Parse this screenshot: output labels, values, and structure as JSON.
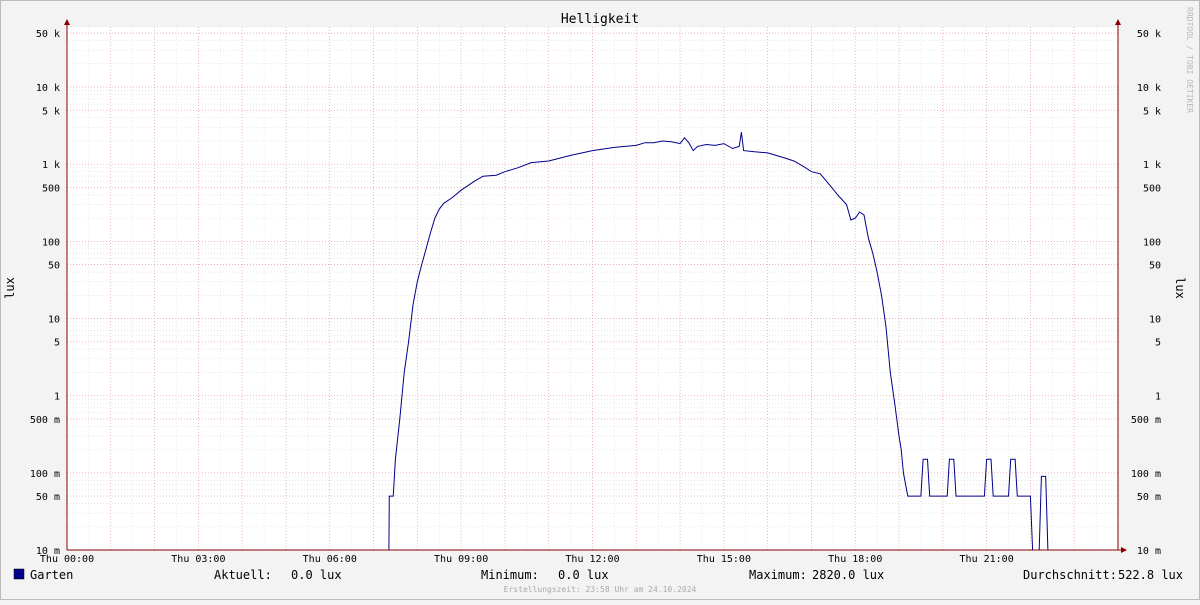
{
  "chart_data": {
    "type": "line",
    "title": "Helligkeit",
    "ylabel": "lux",
    "ylabel_right": "lux",
    "y_scale": "log",
    "ylim": [
      10,
      60000
    ],
    "xlim": [
      0,
      24
    ],
    "x_unit": "hours",
    "y_ticks": [
      {
        "value": 50000,
        "label": "50 k"
      },
      {
        "value": 10000,
        "label": "10 k"
      },
      {
        "value": 5000,
        "label": "5 k"
      },
      {
        "value": 1000,
        "label": "1 k"
      },
      {
        "value": 500,
        "label": "500"
      },
      {
        "value": 100,
        "label": "100"
      },
      {
        "value": 50,
        "label": "50"
      },
      {
        "value": 10,
        "label": "10"
      },
      {
        "value": 5,
        "label": "5"
      },
      {
        "value": 1,
        "label": "1"
      },
      {
        "value": 0.5,
        "label": "500 m"
      },
      {
        "value": 0.1,
        "label": "100 m"
      },
      {
        "value": 0.05,
        "label": "50 m"
      },
      {
        "value": 0.01,
        "label": "10 m"
      }
    ],
    "x_ticks": [
      {
        "value": 0,
        "label": "Thu 00:00"
      },
      {
        "value": 3,
        "label": "Thu 03:00"
      },
      {
        "value": 6,
        "label": "Thu 06:00"
      },
      {
        "value": 9,
        "label": "Thu 09:00"
      },
      {
        "value": 12,
        "label": "Thu 12:00"
      },
      {
        "value": 15,
        "label": "Thu 15:00"
      },
      {
        "value": 18,
        "label": "Thu 18:00"
      },
      {
        "value": 21,
        "label": "Thu 21:00"
      }
    ],
    "series": [
      {
        "name": "Garten",
        "color": "#00008b",
        "points": [
          [
            0,
            0.01
          ],
          [
            7.35,
            0.01
          ],
          [
            7.36,
            0.05
          ],
          [
            7.45,
            0.05
          ],
          [
            7.5,
            0.15
          ],
          [
            7.6,
            0.5
          ],
          [
            7.7,
            2
          ],
          [
            7.8,
            5
          ],
          [
            7.9,
            15
          ],
          [
            8.0,
            30
          ],
          [
            8.1,
            50
          ],
          [
            8.2,
            80
          ],
          [
            8.3,
            130
          ],
          [
            8.4,
            200
          ],
          [
            8.5,
            260
          ],
          [
            8.6,
            310
          ],
          [
            8.8,
            370
          ],
          [
            9.0,
            460
          ],
          [
            9.3,
            600
          ],
          [
            9.5,
            700
          ],
          [
            9.8,
            720
          ],
          [
            10.0,
            800
          ],
          [
            10.3,
            900
          ],
          [
            10.6,
            1050
          ],
          [
            11.0,
            1100
          ],
          [
            11.5,
            1300
          ],
          [
            12.0,
            1500
          ],
          [
            12.5,
            1650
          ],
          [
            13.0,
            1750
          ],
          [
            13.2,
            1900
          ],
          [
            13.4,
            1900
          ],
          [
            13.6,
            2000
          ],
          [
            13.8,
            1950
          ],
          [
            14.0,
            1850
          ],
          [
            14.1,
            2200
          ],
          [
            14.2,
            1900
          ],
          [
            14.3,
            1500
          ],
          [
            14.4,
            1700
          ],
          [
            14.6,
            1800
          ],
          [
            14.8,
            1750
          ],
          [
            15.0,
            1850
          ],
          [
            15.2,
            1600
          ],
          [
            15.35,
            1700
          ],
          [
            15.4,
            2600
          ],
          [
            15.45,
            1500
          ],
          [
            15.7,
            1450
          ],
          [
            16.0,
            1400
          ],
          [
            16.4,
            1200
          ],
          [
            16.6,
            1100
          ],
          [
            16.8,
            950
          ],
          [
            17.0,
            800
          ],
          [
            17.2,
            750
          ],
          [
            17.4,
            550
          ],
          [
            17.6,
            400
          ],
          [
            17.8,
            300
          ],
          [
            17.9,
            190
          ],
          [
            18.0,
            200
          ],
          [
            18.1,
            240
          ],
          [
            18.2,
            220
          ],
          [
            18.3,
            110
          ],
          [
            18.4,
            70
          ],
          [
            18.5,
            40
          ],
          [
            18.6,
            20
          ],
          [
            18.7,
            8
          ],
          [
            18.8,
            2
          ],
          [
            18.9,
            0.8
          ],
          [
            19.0,
            0.3
          ],
          [
            19.05,
            0.2
          ],
          [
            19.1,
            0.1
          ],
          [
            19.2,
            0.05
          ],
          [
            19.5,
            0.05
          ],
          [
            19.55,
            0.15
          ],
          [
            19.65,
            0.15
          ],
          [
            19.7,
            0.05
          ],
          [
            20.1,
            0.05
          ],
          [
            20.15,
            0.15
          ],
          [
            20.25,
            0.15
          ],
          [
            20.3,
            0.05
          ],
          [
            20.95,
            0.05
          ],
          [
            21.0,
            0.15
          ],
          [
            21.1,
            0.15
          ],
          [
            21.15,
            0.05
          ],
          [
            21.5,
            0.05
          ],
          [
            21.55,
            0.15
          ],
          [
            21.65,
            0.15
          ],
          [
            21.7,
            0.05
          ],
          [
            22.0,
            0.05
          ],
          [
            22.05,
            0.01
          ],
          [
            22.2,
            0.01
          ],
          [
            22.25,
            0.09
          ],
          [
            22.35,
            0.09
          ],
          [
            22.4,
            0.01
          ],
          [
            24,
            0.01
          ]
        ]
      }
    ],
    "legend": {
      "name": "Garten",
      "aktuell_label": "Aktuell:",
      "aktuell_value": "0.0 lux",
      "minimum_label": "Minimum:",
      "minimum_value": "0.0 lux",
      "maximum_label": "Maximum:",
      "maximum_value": "2820.0 lux",
      "durchschnitt_label": "Durchschnitt:",
      "durchschnitt_value": "522.8 lux"
    },
    "footer": "Erstellungszeit: 23:58 Uhr am 24.10.2024",
    "watermark": "RRDTOOL / TOBI OETIKER",
    "colors": {
      "background": "#f3f3f3",
      "plot": "#ffffff",
      "grid_minor": "#d9d9d9",
      "grid_major": "#e8a0a0",
      "axis": "#880000",
      "line": "#00008b"
    }
  }
}
